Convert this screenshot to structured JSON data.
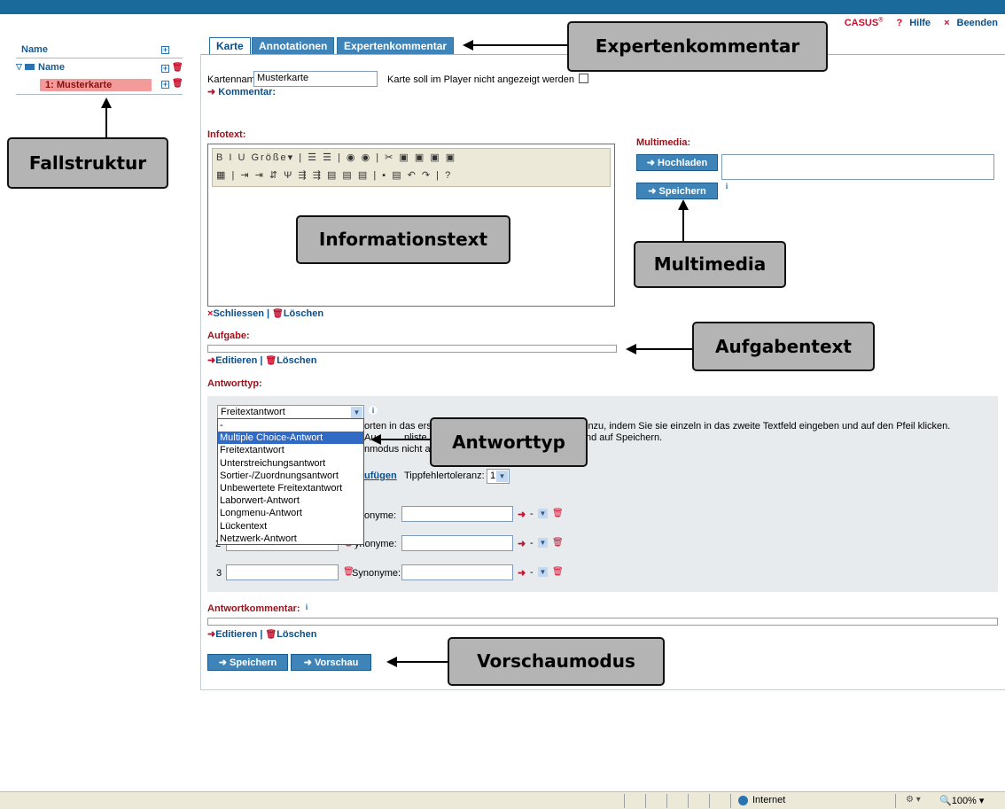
{
  "header": {
    "brand": "CASUS",
    "brand_sup": "®",
    "help_label": "Hilfe",
    "quit_label": "Beenden"
  },
  "tree": {
    "column_header": "Name",
    "root_label": "Name",
    "card_label": "1: Musterkarte"
  },
  "tabs": [
    {
      "label": "Karte"
    },
    {
      "label": "Annotationen"
    },
    {
      "label": "Expertenkommentar"
    }
  ],
  "card": {
    "name_label": "Kartenname:",
    "name_value": "Musterkarte",
    "hide_label": "Karte soll im Player nicht angezeigt werden",
    "comment_label": "Kommentar:"
  },
  "infotext": {
    "label": "Infotext:",
    "toolbar_row1": "B I U Größe▾ | ☰ ☰ | ◉ ◉ | ✂ ▣ ▣ ▣ ▣",
    "toolbar_row2": "▦ | ⇥ ⇥ ⇵ Ψ ⇶ ⇶ ▤ ▤ ▤ | ▪ ▤ ↶ ↷ | ?",
    "close_label": "Schliessen",
    "delete_label": "Löschen"
  },
  "multimedia": {
    "label": "Multimedia:",
    "upload_button": "Hochladen",
    "save_button": "Speichern"
  },
  "aufgabe": {
    "label": "Aufgabe:",
    "edit_label": "Editieren",
    "delete_label": "Löschen"
  },
  "answer": {
    "type_label": "Antworttyp:",
    "selected_type": "Freitextantwort",
    "options": [
      "-",
      "Multiple Choice-Antwort",
      "Freitextantwort",
      "Unterstreichungsantwort",
      "Sortier-/Zuordnungsantwort",
      "Unbewertete Freitextantwort",
      "Laborwert-Antwort",
      "Longmenu-Antwort",
      "Lückentext",
      "Netzwerk-Antwort"
    ],
    "highlighted_option": "Multiple Choice-Antwort",
    "help_line1": "orten in das ers",
    "help_line1b": "inzu, indem Sie sie einzeln in das zweite Textfeld eingeben und auf den Pfeil klicken.",
    "help_line2": "Au",
    "help_line2b": "nliste üb",
    "help_line2c": "nd auf Speichern.",
    "help_line3": "nmodus nicht a",
    "add_link": "ufügen",
    "tolerance_label": "Tippfehlertoleranz:",
    "tolerance_value": "1",
    "synonyms_label": "Synonyme:",
    "synonyms_label_partial": "ynonyme:",
    "synonyms_label_partial2": "onyme:",
    "row3_number": "3",
    "row2_number": "2",
    "row_dash": "-"
  },
  "answer_comment": {
    "label": "Antwortkommentar:",
    "edit_label": "Editieren",
    "delete_label": "Löschen"
  },
  "footer_buttons": {
    "save": "Speichern",
    "preview": "Vorschau"
  },
  "callouts": {
    "expert": "Expertenkommentar",
    "tree": "Fallstruktur",
    "infotext": "Informationstext",
    "multimedia": "Multimedia",
    "task": "Aufgabentext",
    "answer_type": "Antworttyp",
    "preview": "Vorschaumodus"
  },
  "statusbar": {
    "zone": "Internet",
    "zoom": "100%"
  }
}
